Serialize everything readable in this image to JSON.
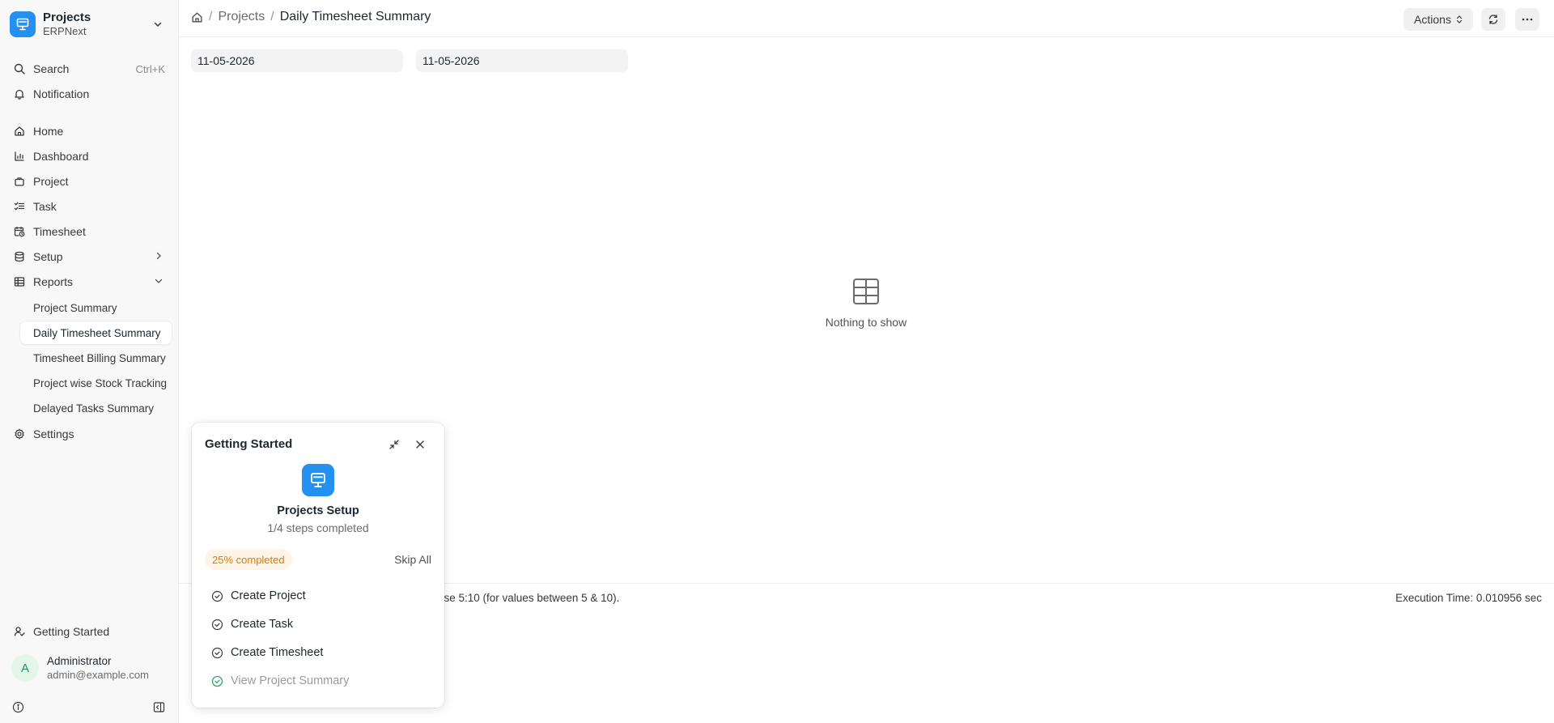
{
  "app": {
    "title": "Projects",
    "subtitle": "ERPNext"
  },
  "sidebar": {
    "search_label": "Search",
    "search_shortcut": "Ctrl+K",
    "notification_label": "Notification",
    "items": [
      {
        "label": "Home",
        "icon": "home-icon"
      },
      {
        "label": "Dashboard",
        "icon": "chart-icon"
      },
      {
        "label": "Project",
        "icon": "briefcase-icon"
      },
      {
        "label": "Task",
        "icon": "checklist-icon"
      },
      {
        "label": "Timesheet",
        "icon": "calendar-clock-icon"
      },
      {
        "label": "Setup",
        "icon": "database-icon"
      },
      {
        "label": "Reports",
        "icon": "table-icon"
      }
    ],
    "reports": [
      "Project Summary",
      "Daily Timesheet Summary",
      "Timesheet Billing Summary",
      "Project wise Stock Tracking",
      "Delayed Tasks Summary"
    ],
    "settings_label": "Settings",
    "getting_started_label": "Getting Started",
    "user": {
      "initial": "A",
      "name": "Administrator",
      "email": "admin@example.com"
    }
  },
  "breadcrumb": {
    "section": "Projects",
    "current": "Daily Timesheet Summary"
  },
  "toolbar": {
    "actions_label": "Actions"
  },
  "filters": {
    "from_date": "11-05-2026",
    "to_date": "11-05-2026"
  },
  "report": {
    "empty_text": "Nothing to show",
    "hint_text": "use 5:10 (for values between 5 & 10).",
    "execution_time": "Execution Time: 0.010956 sec"
  },
  "getting_started": {
    "title": "Getting Started",
    "setup_name": "Projects Setup",
    "steps_text": "1/4 steps completed",
    "progress_fraction": 0.25,
    "progress_label": "25% completed",
    "skip_label": "Skip All",
    "steps": [
      {
        "label": "Create Project",
        "done": false
      },
      {
        "label": "Create Task",
        "done": false
      },
      {
        "label": "Create Timesheet",
        "done": false
      },
      {
        "label": "View Project Summary",
        "done": true
      }
    ]
  },
  "colors": {
    "accent": "#2490ef",
    "badge_bg": "#fff4e5",
    "badge_text": "#d57c0e",
    "done_check": "#30a66d"
  }
}
